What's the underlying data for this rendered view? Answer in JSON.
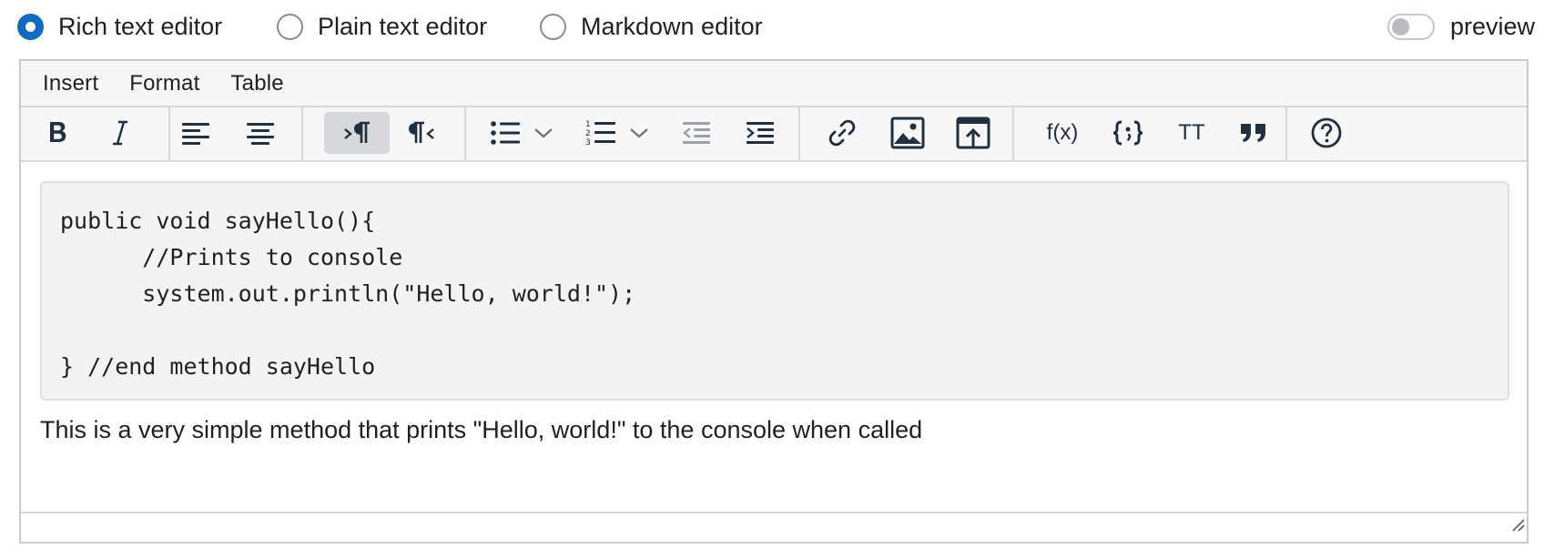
{
  "modes": {
    "rich": "Rich text editor",
    "plain": "Plain text editor",
    "markdown": "Markdown editor",
    "selected": "rich"
  },
  "preview": {
    "label": "preview",
    "enabled": false
  },
  "menubar": {
    "insert": "Insert",
    "format": "Format",
    "table": "Table"
  },
  "toolbar": {
    "buttons": [
      {
        "icon": "bold-icon",
        "active": false
      },
      {
        "icon": "italic-icon",
        "active": false
      },
      {
        "icon": "align-left-icon",
        "active": false
      },
      {
        "icon": "align-center-icon",
        "active": false
      },
      {
        "icon": "ltr-icon",
        "active": true
      },
      {
        "icon": "rtl-icon",
        "active": false
      },
      {
        "icon": "bullet-list-icon",
        "active": false
      },
      {
        "icon": "numbered-list-icon",
        "active": false
      },
      {
        "icon": "outdent-icon",
        "active": false
      },
      {
        "icon": "indent-icon",
        "active": false
      },
      {
        "icon": "link-icon",
        "active": false
      },
      {
        "icon": "image-icon",
        "active": false
      },
      {
        "icon": "media-upload-icon",
        "active": false
      },
      {
        "icon": "equation-icon",
        "active": false
      },
      {
        "icon": "code-sample-icon",
        "active": false
      },
      {
        "icon": "monospace-icon",
        "active": false
      },
      {
        "icon": "blockquote-icon",
        "active": false
      },
      {
        "icon": "help-icon",
        "active": false
      }
    ],
    "equation_label": "f(x)",
    "monospace_label": "TT"
  },
  "content": {
    "code_lines": [
      "public void sayHello(){",
      "      //Prints to console",
      "      system.out.println(\"Hello, world!\");",
      "",
      "} //end method sayHello"
    ],
    "paragraph": "This is a very simple method that prints \"Hello, world!\" to the console when called"
  },
  "colors": {
    "accent": "#0f6cbf",
    "toolbar_bg": "#f7f7f8",
    "border": "#c9cccf",
    "code_bg": "#f3f3f3"
  }
}
